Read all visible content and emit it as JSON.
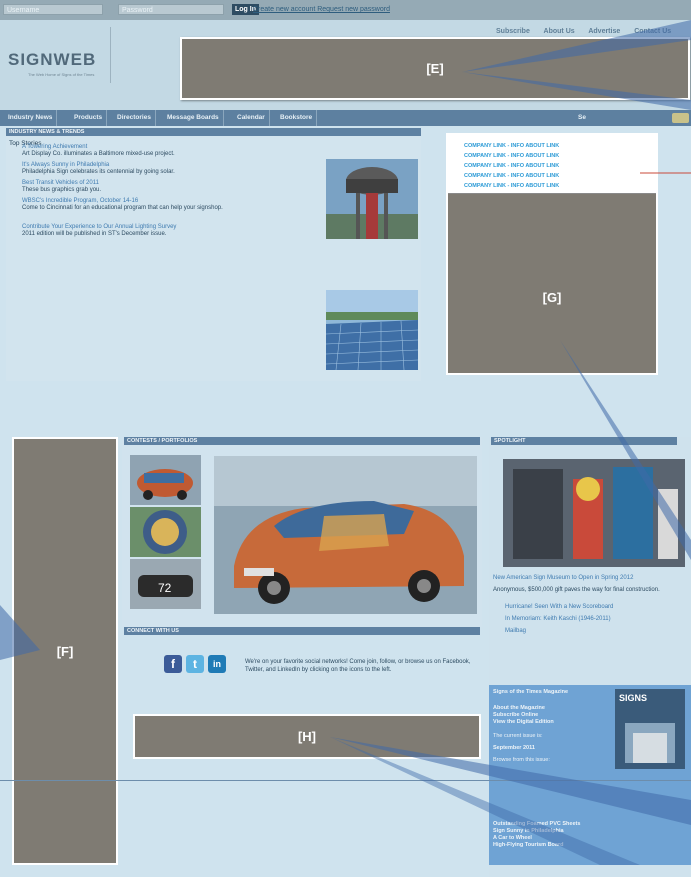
{
  "topbar": {
    "username_placeholder": "Username",
    "password_placeholder": "Password",
    "login_label": "Log In",
    "links_text": "Create new account  Request new password"
  },
  "header": {
    "logo": "SIGNWEB",
    "tagline": "The Web Home of Signs of the Times",
    "nav": [
      "Subscribe",
      "About Us",
      "Advertise",
      "Contact Us"
    ]
  },
  "mainnav": {
    "items": [
      "Industry News",
      "Products",
      "Directories",
      "Message Boards",
      "Calendar",
      "Bookstore"
    ],
    "search_label": "Se"
  },
  "industry": {
    "heading": "INDUSTRY NEWS & TRENDS",
    "top_stories_label": "Top Stories",
    "stories": [
      {
        "title": "A Towering Achievement",
        "desc": "Art Display Co. illuminates a Baltimore mixed-use project."
      },
      {
        "title": "It's Always Sunny in Philadelphia",
        "desc": "Philadelphia Sign celebrates its centennial by going solar."
      },
      {
        "title": "Best Transit Vehicles of 2011",
        "desc": "These bus graphics grab you."
      },
      {
        "title": "WBSC's Incredible Program, October 14-16",
        "desc": "Come to Cincinnati for an educational program that can help your signshop."
      },
      {
        "title": "Contribute Your Experience to Our Annual Lighting Survey",
        "desc": "2011 edition will be published in ST's December issue."
      }
    ]
  },
  "annotations": {
    "E": "[E]",
    "F": "[F]",
    "G": "[G]",
    "H": "[H]"
  },
  "links_card": {
    "links": [
      "COMPANY LINK - INFO ABOUT LINK",
      "COMPANY LINK - INFO ABOUT LINK",
      "COMPANY LINK - INFO ABOUT LINK",
      "COMPANY LINK - INFO ABOUT LINK",
      "COMPANY LINK - INFO ABOUT LINK"
    ]
  },
  "contests": {
    "heading": "CONTESTS / PORTFOLIOS"
  },
  "connect": {
    "heading": "CONNECT WITH US",
    "text": "We're on your favorite social networks! Come join, follow, or browse us on Facebook, Twitter, and LinkedIn by clicking on the icons to the left.",
    "icons": [
      "f",
      "t",
      "in"
    ]
  },
  "spotlight": {
    "heading": "SPOTLIGHT",
    "headline": "New American Sign Museum to Open in Spring 2012",
    "desc": "Anonymous, $500,000 gift paves the way for final construction.",
    "links": [
      "Hurricane! Seen With a New Scoreboard",
      "In Memoriam: Keith Kaschi (1946-2011)",
      "Mailbag"
    ]
  },
  "magazine": {
    "title": "Signs of the Times Magazine",
    "lines": [
      "About the Magazine",
      "Subscribe Online",
      "View the Digital Edition"
    ],
    "current_label": "The current issue is:",
    "current_issue": "September 2011",
    "browse": "Browse from this issue:",
    "cover_title": "SIGNS",
    "articles": [
      "Outstanding Foamed PVC Sheets",
      "Sign Sunny in Philadelphia",
      "A Car to Wheel",
      "High-Flying Tourism Board"
    ]
  },
  "colors": {
    "nav_bg": "#5d80a0",
    "link": "#3f7bb0",
    "annotation_gray": "#7f7b73",
    "company_link": "#2b9ad6"
  }
}
